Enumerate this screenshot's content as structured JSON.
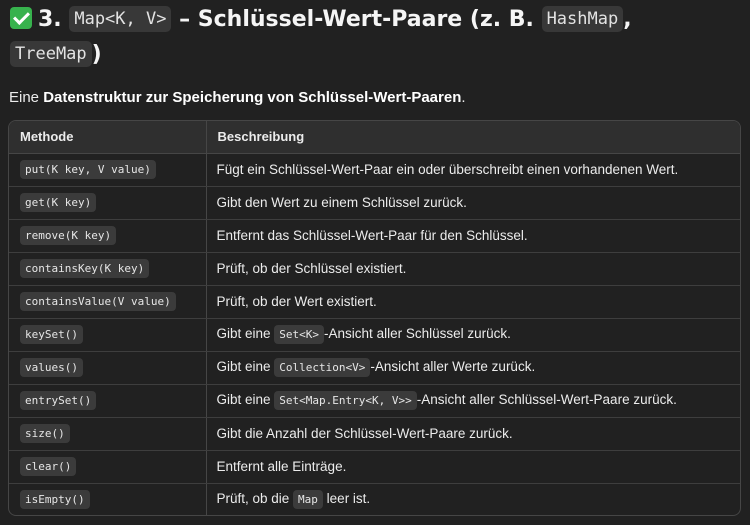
{
  "heading": {
    "number": "3.",
    "code1": "Map<K, V>",
    "text1": " – Schlüssel-Wert-Paare (z. B. ",
    "code2": "HashMap",
    "sep": ",",
    "code3": "TreeMap",
    "close": ")",
    "icon": "check-mark-button-icon",
    "icon_color": "#37b24d"
  },
  "intro": {
    "prefix": "Eine ",
    "bold": "Datenstruktur zur Speicherung von Schlüssel-Wert-Paaren",
    "suffix": "."
  },
  "table": {
    "headers": [
      "Methode",
      "Beschreibung"
    ],
    "rows": [
      {
        "method": "put(K key, V value)",
        "desc": "Fügt ein Schlüssel-Wert-Paar ein oder überschreibt einen vorhandenen Wert."
      },
      {
        "method": "get(K key)",
        "desc": "Gibt den Wert zu einem Schlüssel zurück."
      },
      {
        "method": "remove(K key)",
        "desc": "Entfernt das Schlüssel-Wert-Paar für den Schlüssel."
      },
      {
        "method": "containsKey(K key)",
        "desc": "Prüft, ob der Schlüssel existiert."
      },
      {
        "method": "containsValue(V value)",
        "desc": "Prüft, ob der Wert existiert."
      },
      {
        "method": "keySet()",
        "desc_pre": "Gibt eine ",
        "desc_code": "Set<K>",
        "desc_post": "-Ansicht aller Schlüssel zurück."
      },
      {
        "method": "values()",
        "desc_pre": "Gibt eine ",
        "desc_code": "Collection<V>",
        "desc_post": "-Ansicht aller Werte zurück."
      },
      {
        "method": "entrySet()",
        "desc_pre": "Gibt eine ",
        "desc_code": "Set<Map.Entry<K, V>>",
        "desc_post": "-Ansicht aller Schlüssel-Wert-Paare zurück."
      },
      {
        "method": "size()",
        "desc": "Gibt die Anzahl der Schlüssel-Wert-Paare zurück."
      },
      {
        "method": "clear()",
        "desc": "Entfernt alle Einträge."
      },
      {
        "method": "isEmpty()",
        "desc_pre": "Prüft, ob die ",
        "desc_code": "Map",
        "desc_post": " leer ist."
      }
    ]
  }
}
